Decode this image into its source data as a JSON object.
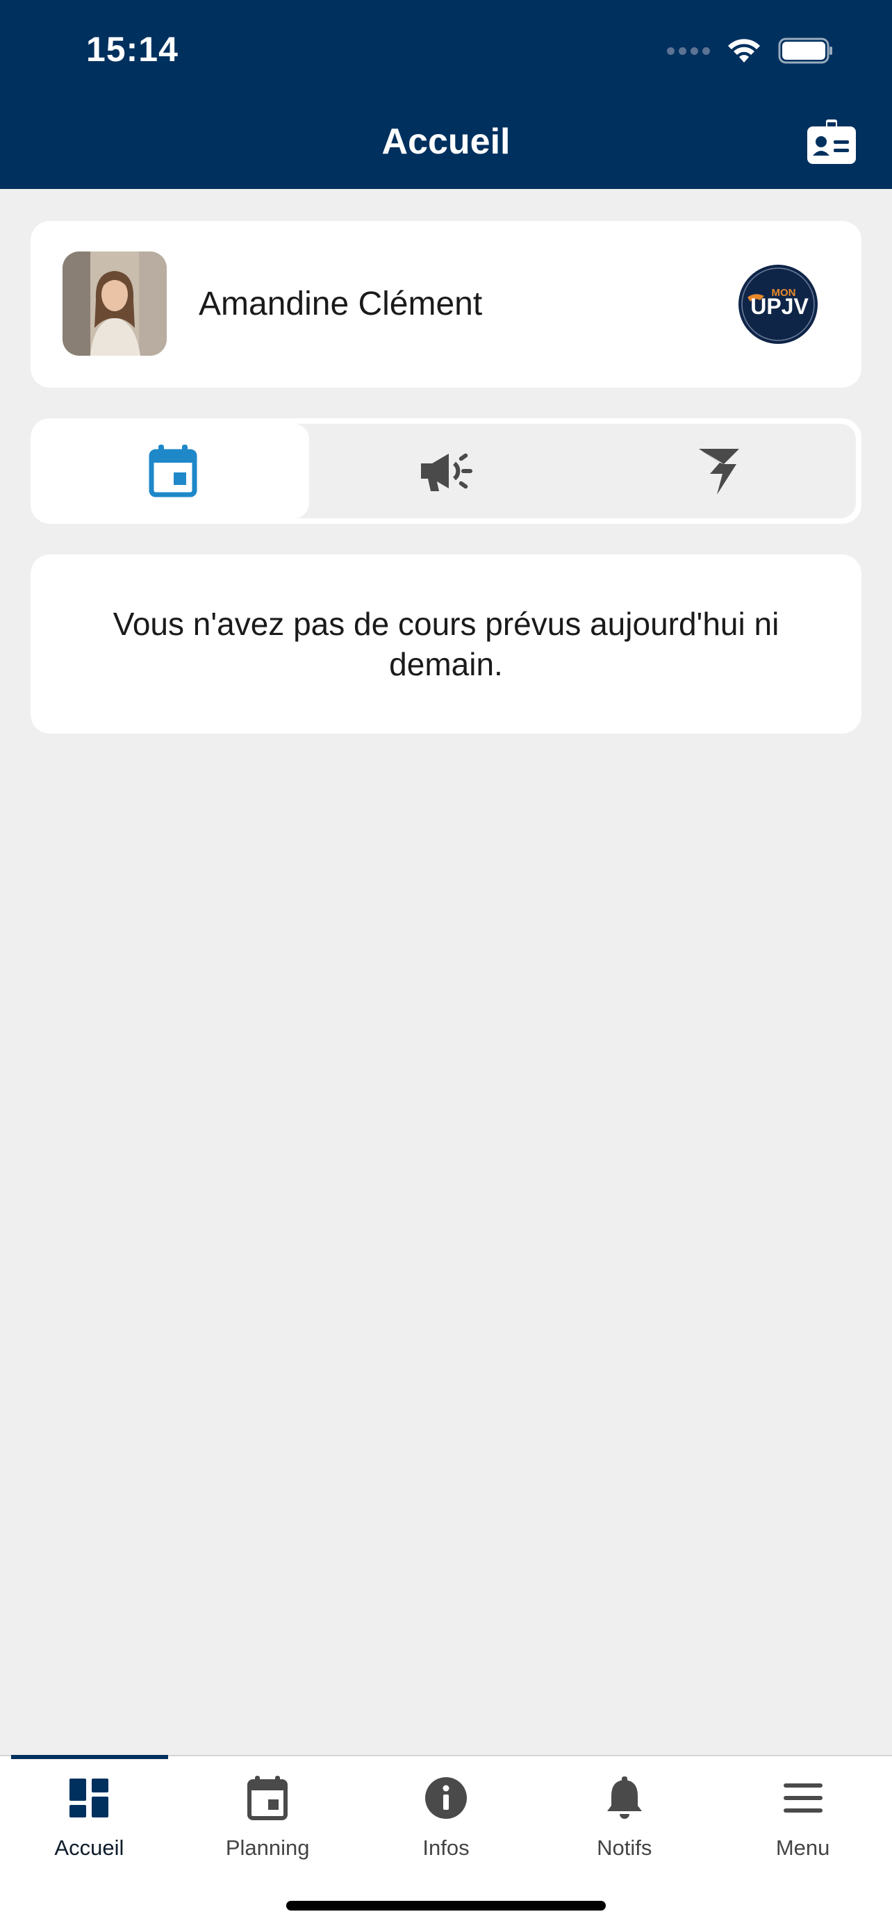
{
  "status_bar": {
    "time": "15:14"
  },
  "header": {
    "title": "Accueil",
    "id_card_icon": "id-card-icon"
  },
  "profile": {
    "name": "Amandine Clément",
    "logo": {
      "top": "MON",
      "bottom": "UPJV"
    }
  },
  "tabs": [
    {
      "icon": "calendar-icon",
      "active": true
    },
    {
      "icon": "megaphone-icon",
      "active": false
    },
    {
      "icon": "bolt-icon",
      "active": false
    }
  ],
  "message": "Vous n'avez pas de cours prévus aujourd'hui ni demain.",
  "bottom_nav": {
    "items": [
      {
        "label": "Accueil",
        "icon": "dashboard-icon",
        "active": true
      },
      {
        "label": "Planning",
        "icon": "calendar-icon",
        "active": false
      },
      {
        "label": "Infos",
        "icon": "info-icon",
        "active": false
      },
      {
        "label": "Notifs",
        "icon": "bell-icon",
        "active": false
      },
      {
        "label": "Menu",
        "icon": "menu-icon",
        "active": false
      }
    ]
  },
  "colors": {
    "header_bg": "#00305e",
    "accent_blue": "#1e88c9",
    "page_bg": "#efefef",
    "icon_gray": "#4a4a4a"
  }
}
